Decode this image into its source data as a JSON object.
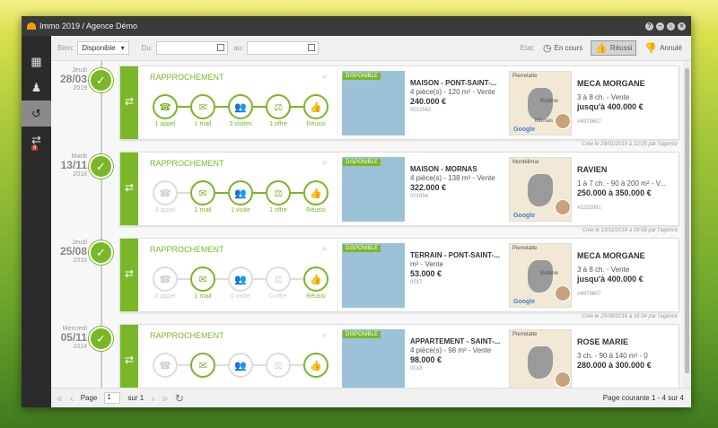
{
  "window": {
    "title": "Immo 2019 / Agence Démo"
  },
  "toolbar": {
    "bien_label": "Bien:",
    "bien_value": "Disponible",
    "du_label": "Du:",
    "au_label": "au:",
    "etat_label": "Etat:",
    "en_cours": "En cours",
    "reussi": "Réussi",
    "annule": "Annulé"
  },
  "sidebar": {
    "badge": "8"
  },
  "entries": [
    {
      "day": "Jeudi",
      "date": "28/03",
      "year": "2019",
      "title": "RAPPROCHEMENT",
      "steps": [
        {
          "label": "1 appel",
          "on": true
        },
        {
          "label": "1 mail",
          "on": true
        },
        {
          "label": "3 visites",
          "on": true
        },
        {
          "label": "1 offre",
          "on": true
        },
        {
          "label": "Réussi",
          "on": true
        }
      ],
      "badge": "DISPONIBLE",
      "prop_title": "MAISON - PONT-SAINT-...",
      "prop_desc": "4 pièce(s) - 120 m² - Vente",
      "price": "240.000 €",
      "ref": "0013562",
      "map_city": "Pierrelatte",
      "map_city2": "Bollène",
      "map_city3": "Mornas",
      "google": "Google",
      "client": "MECA MORGANE",
      "client_desc": "3 à 8 ch. - Vente",
      "budget": "jusqu'à 400.000 €",
      "client_ref": "#4979607",
      "created": "Crée le 29/01/2019 à 10:05 par l'agence"
    },
    {
      "day": "Mardi",
      "date": "13/11",
      "year": "2018",
      "title": "RAPPROCHEMENT",
      "steps": [
        {
          "label": "0 appel",
          "on": false
        },
        {
          "label": "1 mail",
          "on": true
        },
        {
          "label": "1 visite",
          "on": true
        },
        {
          "label": "1 offre",
          "on": true
        },
        {
          "label": "Réussi",
          "on": true
        }
      ],
      "badge": "DISPONIBLE",
      "prop_title": "MAISON - MORNAS",
      "prop_desc": "4 pièce(s) - 138 m² - Vente",
      "price": "322.000 €",
      "ref": "001654",
      "map_city": "Montélimar",
      "map_city2": "",
      "map_city3": "",
      "google": "Google",
      "client": "RAVIEN",
      "client_desc": "1 à 7 ch. - 90 à 200 m² - V...",
      "budget": "250.000 à 350.000 €",
      "client_ref": "#5255091",
      "created": "Crée le 13/11/2018 à 09:58 par l'agence"
    },
    {
      "day": "Jeudi",
      "date": "25/08",
      "year": "2016",
      "title": "RAPPROCHEMENT",
      "steps": [
        {
          "label": "0 appel",
          "on": false
        },
        {
          "label": "1 mail",
          "on": true
        },
        {
          "label": "0 visite",
          "on": false
        },
        {
          "label": "0 offre",
          "on": false
        },
        {
          "label": "Réussi",
          "on": true
        }
      ],
      "badge": "DISPONIBLE",
      "prop_title": "TERRAIN - PONT-SAINT-...",
      "prop_desc": "m² - Vente",
      "price": "53.000 €",
      "ref": "0017",
      "map_city": "Pierrelatte",
      "map_city2": "Bollène",
      "map_city3": "",
      "google": "Google",
      "client": "MECA MORGANE",
      "client_desc": "3 à 8 ch. - Vente",
      "budget": "jusqu'à 400.000 €",
      "client_ref": "#4979607",
      "created": "Crée le 25/08/2016 à 16:34 par l'agence"
    },
    {
      "day": "Mercredi",
      "date": "05/11",
      "year": "2014",
      "title": "RAPPROCHEMENT",
      "steps": [
        {
          "label": "",
          "on": false
        },
        {
          "label": "",
          "on": true
        },
        {
          "label": "",
          "on": false
        },
        {
          "label": "",
          "on": false
        },
        {
          "label": "",
          "on": true
        }
      ],
      "badge": "DISPONIBLE",
      "prop_title": "APPARTEMENT - SAINT-...",
      "prop_desc": "4 pièce(s) - 98 m² - Vente",
      "price": "98.000 €",
      "ref": "0013",
      "map_city": "Pierrelatte",
      "map_city2": "",
      "map_city3": "",
      "google": "",
      "client": "ROSE MARIE",
      "client_desc": "3 ch. - 90 à 140 m² - 0",
      "budget": "280.000 à 300.000 €",
      "client_ref": "",
      "created": ""
    }
  ],
  "footer": {
    "page_label": "Page",
    "page_value": "1",
    "sur": "sur 1",
    "courante": "Page courante 1 - 4 sur 4"
  }
}
